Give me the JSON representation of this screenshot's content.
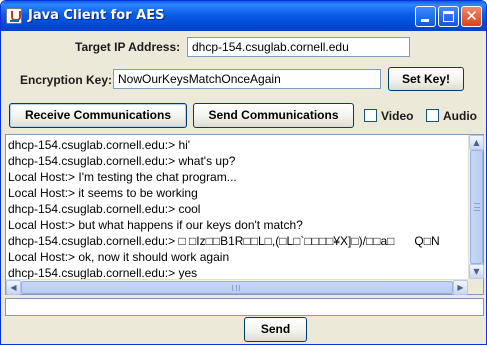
{
  "window": {
    "title": "Java Client for AES",
    "app_icon": "java-cup-icon",
    "controls": {
      "minimize": "minimize-icon",
      "maximize": "maximize-icon",
      "close_symbol": "✕"
    }
  },
  "connection": {
    "target_ip_label": "Target IP Address:",
    "target_ip_value": "dhcp-154.csuglab.cornell.edu",
    "encryption_key_label": "Encryption Key:",
    "encryption_key_value": "NowOurKeysMatchOnceAgain",
    "set_key_button": "Set Key!"
  },
  "actions": {
    "receive_button": "Receive Communications",
    "send_comm_button": "Send Communications",
    "video_label": "Video",
    "video_checked": false,
    "audio_label": "Audio",
    "audio_checked": false
  },
  "chat": {
    "lines": [
      "dhcp-154.csuglab.cornell.edu:> hi'",
      "dhcp-154.csuglab.cornell.edu:> what's up?",
      "Local Host:> I'm testing the chat program...",
      "Local Host:> it seems to be working",
      "dhcp-154.csuglab.cornell.edu:> cool",
      "Local Host:> but what happens if our keys don't match?",
      "dhcp-154.csuglab.cornell.edu:> □ □Iz□□B1R□□L□,(□L□`□□□□¥X]□)/□□a□      Q□N",
      "Local Host:> ok, now it should work again",
      "dhcp-154.csuglab.cornell.edu:> yes"
    ]
  },
  "composer": {
    "message_value": "",
    "send_button": "Send"
  }
}
